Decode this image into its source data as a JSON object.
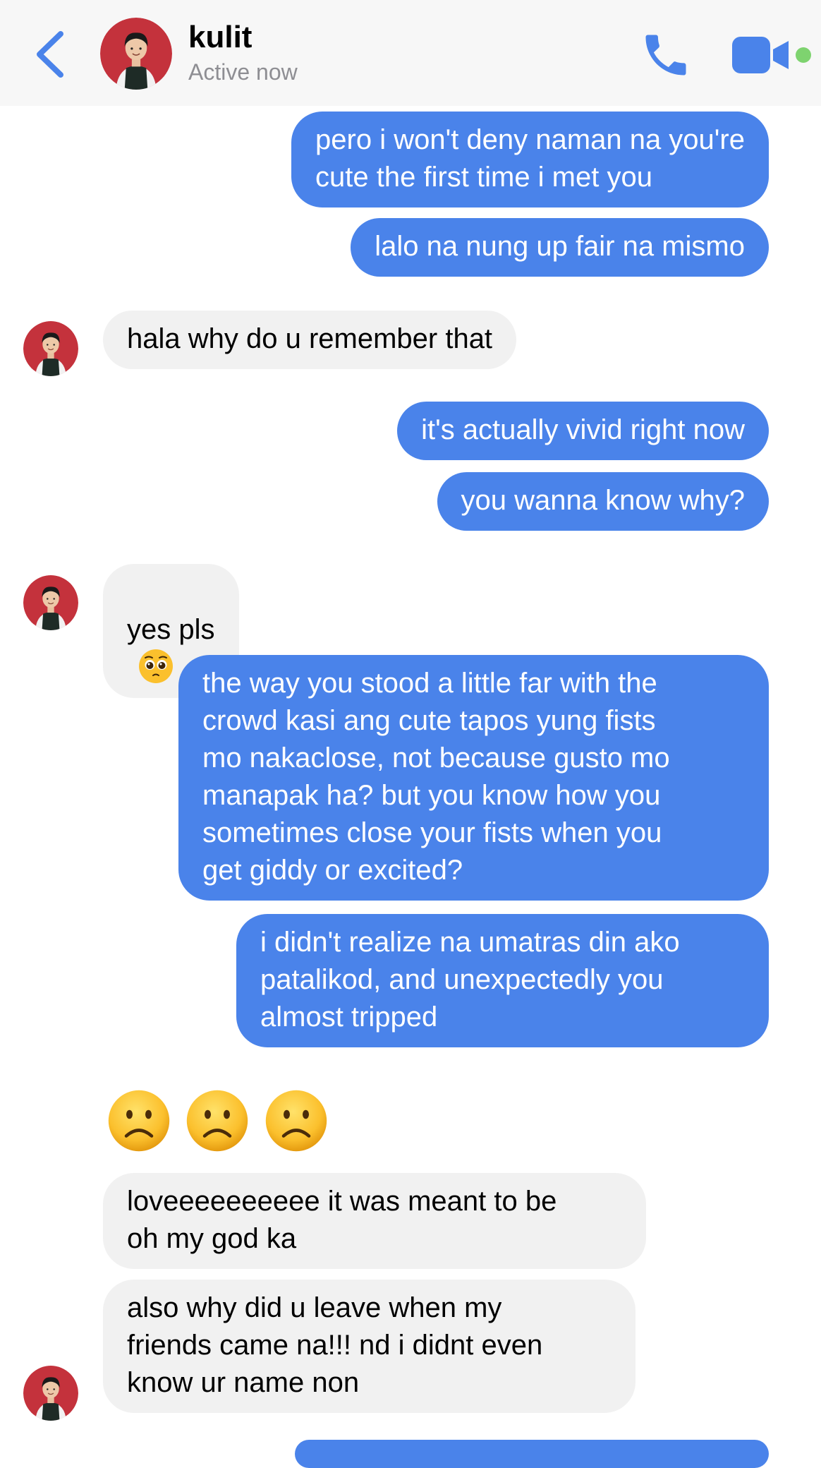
{
  "header": {
    "contact_name": "kulit",
    "status": "Active now"
  },
  "colors": {
    "accent": "#4a83ea",
    "sent_bubble": "#4a83ea",
    "received_bubble": "#f1f1f1",
    "online": "#7ed36f"
  },
  "icons": [
    "chevron-left-icon",
    "phone-icon",
    "video-camera-icon",
    "sad-face-emoji",
    "pleading-face-emoji"
  ],
  "messages": [
    {
      "from": "me",
      "text": "pero i won't deny naman na you're\ncute the first time i met you"
    },
    {
      "from": "me",
      "text": "lalo na nung up fair na mismo"
    },
    {
      "from": "them",
      "text": "hala why do u remember that"
    },
    {
      "from": "me",
      "text": "it's actually vivid right now"
    },
    {
      "from": "me",
      "text": "you wanna know why?"
    },
    {
      "from": "them",
      "text": "yes pls"
    },
    {
      "from": "me",
      "text": "the way you stood a little far with the\ncrowd kasi ang cute tapos yung fists\nmo nakaclose, not because gusto mo\nmanapak ha? but you know how you\nsometimes close your fists when you\nget giddy or excited?"
    },
    {
      "from": "me",
      "text": "i didn't realize na umatras din ako\npatalikod, and unexpectedly you\nalmost tripped"
    },
    {
      "from": "them",
      "text": "loveeeeeeeeee it was meant to be\noh my god ka"
    },
    {
      "from": "them",
      "text": "also why did u leave when my\nfriends came na!!! nd i didnt even\nknow ur name non"
    }
  ]
}
